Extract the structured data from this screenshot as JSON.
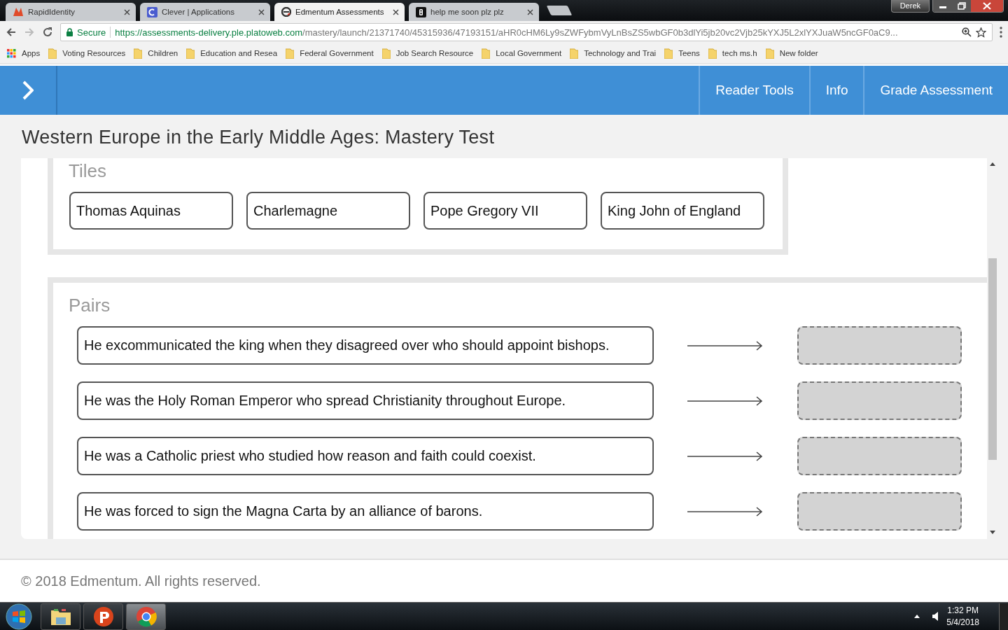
{
  "browser": {
    "tabs": [
      {
        "title": "RapidIdentity",
        "selected": false
      },
      {
        "title": "Clever | Applications",
        "selected": false
      },
      {
        "title": "Edmentum Assessments",
        "selected": true
      },
      {
        "title": "help me soon plz plz",
        "selected": false
      }
    ],
    "user": "Derek",
    "secure_label": "Secure",
    "url_host": "https://assessments-delivery.ple.platoweb.com",
    "url_path": "/mastery/launch/21371740/45315936/47193151/aHR0cHM6Ly9sZWFybmVyLnBsZS5wbGF0b3dlYi5jb20vc2Vjb25kYXJ5L2xlYXJuaW5ncGF0aC9...",
    "bookmarks": [
      {
        "label": "Apps",
        "kind": "apps"
      },
      {
        "label": "Voting Resources",
        "kind": "folder"
      },
      {
        "label": "Children",
        "kind": "folder"
      },
      {
        "label": "Education and Resea",
        "kind": "folder"
      },
      {
        "label": "Federal Government",
        "kind": "folder"
      },
      {
        "label": "Job Search Resource",
        "kind": "folder"
      },
      {
        "label": "Local Government",
        "kind": "folder"
      },
      {
        "label": "Technology and Trai",
        "kind": "folder"
      },
      {
        "label": "Teens",
        "kind": "folder"
      },
      {
        "label": "tech ms.h",
        "kind": "folder"
      },
      {
        "label": "New folder",
        "kind": "folder"
      }
    ]
  },
  "header": {
    "nav": [
      "Reader Tools",
      "Info",
      "Grade Assessment"
    ]
  },
  "page_title": "Western Europe in the Early Middle Ages: Mastery Test",
  "tiles": {
    "heading": "Tiles",
    "items": [
      "Thomas Aquinas",
      "Charlemagne",
      "Pope Gregory VII",
      "King John of England"
    ]
  },
  "pairs": {
    "heading": "Pairs",
    "items": [
      {
        "text": "He excommunicated the king when they disagreed over who should appoint bishops."
      },
      {
        "text": "He was the Holy Roman Emperor who spread Christianity throughout Europe."
      },
      {
        "text": "He was a Catholic priest who studied how reason and faith could coexist."
      },
      {
        "text": "He was forced to sign the Magna Carta by an alliance of barons."
      }
    ]
  },
  "footer": "© 2018 Edmentum. All rights reserved.",
  "taskbar": {
    "apps": [
      {
        "kind": "explorer",
        "selected": false
      },
      {
        "kind": "psiphon",
        "selected": false
      },
      {
        "kind": "chrome",
        "selected": true
      }
    ],
    "time": "1:32 PM",
    "date": "5/4/2018"
  }
}
